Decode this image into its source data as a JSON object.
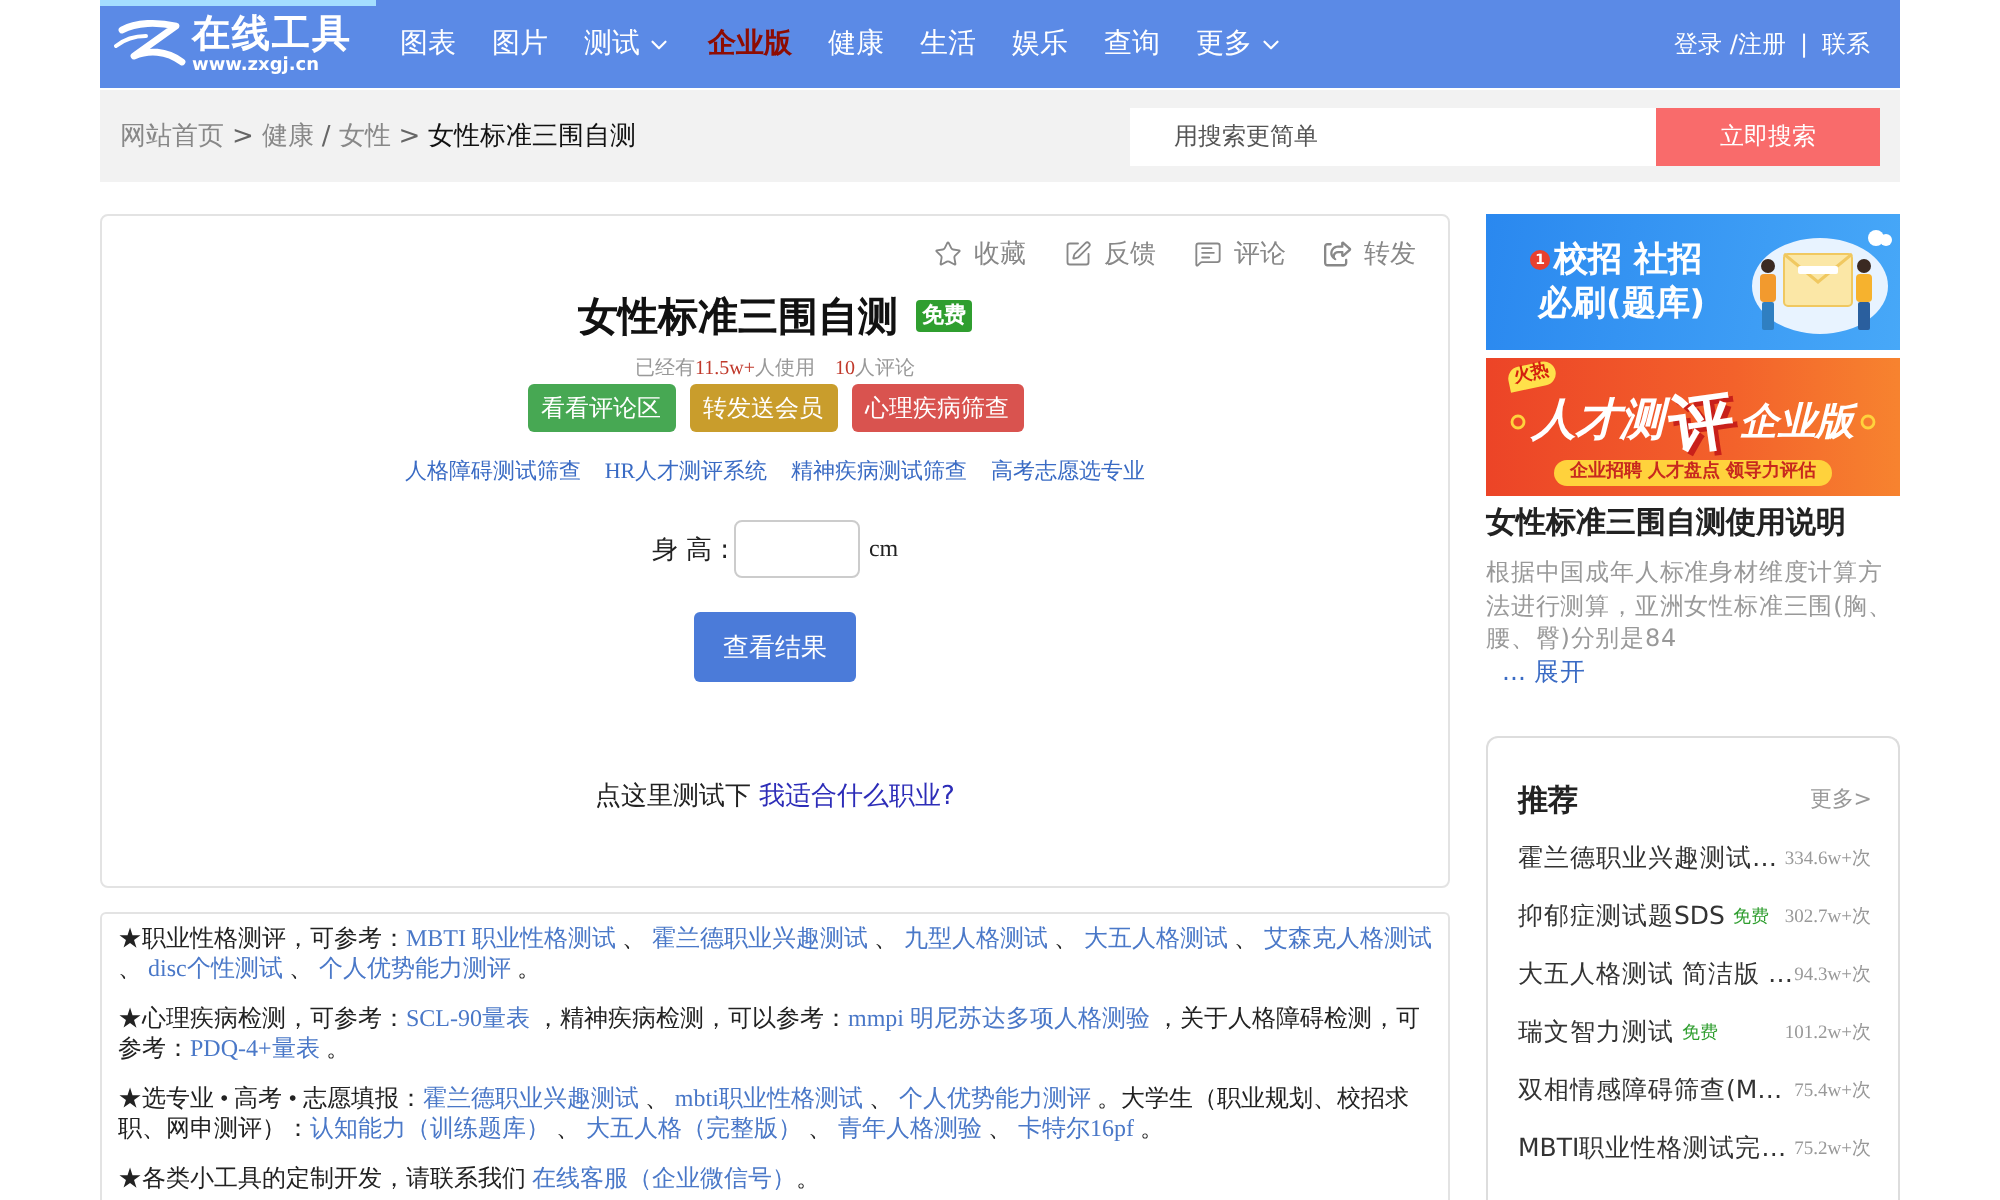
{
  "header": {
    "loading_bar": {
      "level": 0.153
    },
    "logo": {
      "title": "在线工具",
      "url": "www.zxgj.cn"
    },
    "nav": [
      {
        "label": "图表",
        "kind": "link",
        "highlight": false
      },
      {
        "label": "图片",
        "kind": "link",
        "highlight": false
      },
      {
        "label": "测试",
        "kind": "dropdown",
        "highlight": false
      },
      {
        "label": "企业版",
        "kind": "link",
        "highlight": true
      },
      {
        "label": "健康",
        "kind": "link",
        "highlight": false
      },
      {
        "label": "生活",
        "kind": "link",
        "highlight": false
      },
      {
        "label": "娱乐",
        "kind": "link",
        "highlight": false
      },
      {
        "label": "查询",
        "kind": "link",
        "highlight": false
      },
      {
        "label": "更多",
        "kind": "dropdown",
        "highlight": false
      }
    ],
    "account": {
      "links": [
        "登录 /注册",
        "联系"
      ],
      "separator": "|"
    }
  },
  "breadcrumb": [
    {
      "label": "网站首页",
      "current": false
    },
    {
      "separator": ">",
      "label": "健康",
      "current": false
    },
    {
      "separator": "/",
      "label": "女性",
      "current": false
    },
    {
      "separator": ">",
      "label": "女性标准三围自测",
      "current": true
    }
  ],
  "search": {
    "placeholder": "用搜索更简单",
    "button": "立即搜索"
  },
  "tool": {
    "actions": [
      {
        "kind": "favorite",
        "label": "收藏"
      },
      {
        "kind": "feedback",
        "label": "反馈"
      },
      {
        "kind": "comment",
        "label": "评论"
      },
      {
        "kind": "share",
        "label": "转发"
      }
    ],
    "title": "女性标准三围自测",
    "badge": "免费",
    "stats": {
      "prefix": "已经有",
      "users": "11.5w+",
      "users_suffix": "人使用",
      "comments": "10",
      "comments_suffix": "人评论"
    },
    "buttons": [
      {
        "kind": "success",
        "label": "看看评论区"
      },
      {
        "kind": "warning",
        "label": "转发送会员"
      },
      {
        "kind": "danger",
        "label": "心理疾病筛查"
      }
    ],
    "related_links": [
      "人格障碍测试筛查",
      "HR人才测评系统",
      "精神疾病测试筛查",
      "高考志愿选专业"
    ],
    "form": {
      "label": "身 高 :",
      "unit": "cm",
      "submit": "查看结果"
    },
    "prompt": {
      "text": "点这里测试下",
      "link": "我适合什么职业?"
    }
  },
  "references": [
    {
      "segments": [
        {
          "kind": "text",
          "text": "★职业性格测评，可参考："
        },
        {
          "kind": "link",
          "text": "MBTI 职业性格测试"
        },
        {
          "kind": "text",
          "text": " 、 "
        },
        {
          "kind": "link",
          "text": "霍兰德职业兴趣测试"
        },
        {
          "kind": "text",
          "text": " 、 "
        },
        {
          "kind": "link",
          "text": "九型人格测试"
        },
        {
          "kind": "text",
          "text": " 、 "
        },
        {
          "kind": "link",
          "text": "大五人格测试"
        },
        {
          "kind": "text",
          "text": " 、 "
        },
        {
          "kind": "link",
          "text": "艾森克人格测试"
        },
        {
          "kind": "text",
          "text": " 、 "
        },
        {
          "kind": "link",
          "text": "disc个性测试"
        },
        {
          "kind": "text",
          "text": " 、 "
        },
        {
          "kind": "link",
          "text": "个人优势能力测评"
        },
        {
          "kind": "text",
          "text": " 。"
        }
      ]
    },
    {
      "segments": [
        {
          "kind": "text",
          "text": "★心理疾病检测，可参考："
        },
        {
          "kind": "link",
          "text": "SCL-90量表"
        },
        {
          "kind": "text",
          "text": " ，精神疾病检测，可以参考："
        },
        {
          "kind": "link",
          "text": "mmpi 明尼苏达多项人格测验"
        },
        {
          "kind": "text",
          "text": " ，关于人格障碍检测，可参考："
        },
        {
          "kind": "link",
          "text": "PDQ-4+量表"
        },
        {
          "kind": "text",
          "text": " 。"
        }
      ]
    },
    {
      "segments": [
        {
          "kind": "text",
          "text": "★选专业 • 高考 • 志愿填报："
        },
        {
          "kind": "link",
          "text": "霍兰德职业兴趣测试"
        },
        {
          "kind": "text",
          "text": " 、 "
        },
        {
          "kind": "link",
          "text": "mbti职业性格测试"
        },
        {
          "kind": "text",
          "text": " 、 "
        },
        {
          "kind": "link",
          "text": "个人优势能力测评"
        },
        {
          "kind": "text",
          "text": " 。大学生（职业规划、校招求职、网申测评）："
        },
        {
          "kind": "link",
          "text": "认知能力（训练题库）"
        },
        {
          "kind": "text",
          "text": " 、 "
        },
        {
          "kind": "link",
          "text": "大五人格（完整版）"
        },
        {
          "kind": "text",
          "text": " 、 "
        },
        {
          "kind": "link",
          "text": "青年人格测验"
        },
        {
          "kind": "text",
          "text": " 、 "
        },
        {
          "kind": "link",
          "text": "卡特尔16pf"
        },
        {
          "kind": "text",
          "text": " 。"
        }
      ]
    },
    {
      "segments": [
        {
          "kind": "text",
          "text": "★各类小工具的定制开发，请联系我们 "
        },
        {
          "kind": "link",
          "text": "在线客服（企业微信号）"
        },
        {
          "kind": "text",
          "text": "。"
        }
      ]
    }
  ],
  "sidebar": {
    "banners": [
      {
        "kind": "campus",
        "badge": "1",
        "lines": [
          "校招 社招",
          "必刷(题库)"
        ]
      },
      {
        "kind": "enterprise",
        "tag": "火热",
        "headline": "人才测",
        "highlight": "评",
        "suffix": "企业版",
        "subtitle": "企业招聘 人才盘点 领导力评估"
      }
    ],
    "guide": {
      "title": "女性标准三围自测使用说明",
      "description": "根据中国成年人标准身材维度计算方法进行测算，亚洲女性标准三围(胸、腰、臀)分别是84",
      "expand": "... 展开"
    },
    "recommend": {
      "title": "推荐",
      "more": "更多>",
      "items": [
        {
          "title": "霍兰德职业兴趣测试…",
          "count": "334.6w+次"
        },
        {
          "title": "抑郁症测试题SDS",
          "tag": "免费",
          "count": "302.7w+次"
        },
        {
          "title": "大五人格测试 简洁版 …",
          "count": "94.3w+次"
        },
        {
          "title": "瑞文智力测试",
          "tag": "免费",
          "count": "101.2w+次"
        },
        {
          "title": "双相情感障碍筛查(M…",
          "count": "75.4w+次"
        },
        {
          "title": "MBTI职业性格测试完…",
          "count": "75.2w+次"
        }
      ]
    }
  }
}
